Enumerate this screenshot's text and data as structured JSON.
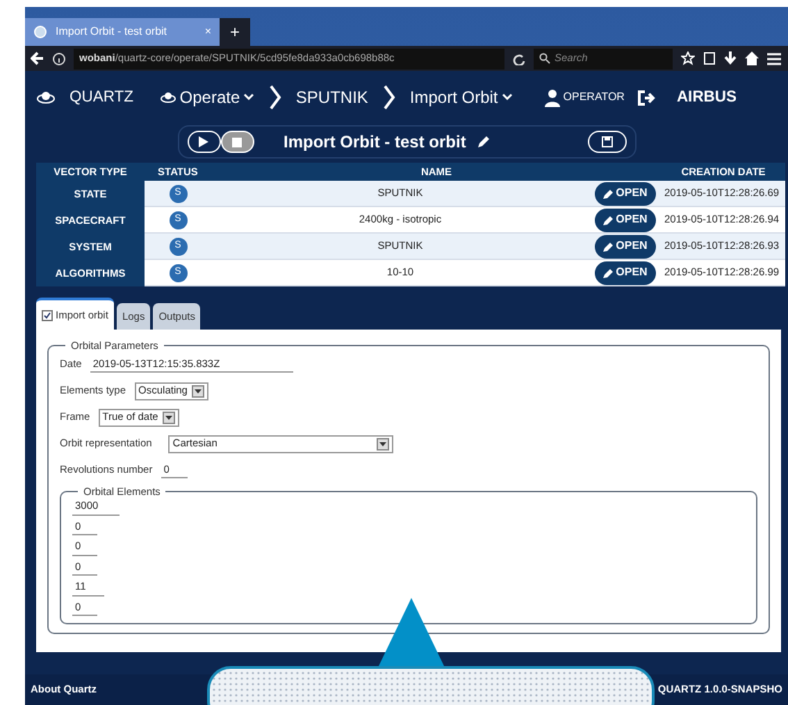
{
  "browser": {
    "tab_title": "Import Orbit - test orbit",
    "tab_close": "×",
    "new_tab": "+",
    "url_host": "wobani",
    "url_path": "/quartz-core/operate/SPUTNIK/5cd95fe8da933a0cb698b88c",
    "search_placeholder": "Search"
  },
  "nav": {
    "brand": "QUARTZ",
    "crumbs": [
      {
        "label": "Operate",
        "dropdown": true,
        "icon": true
      },
      {
        "label": "SPUTNIK",
        "dropdown": false,
        "icon": false
      },
      {
        "label": "Import Orbit",
        "dropdown": true,
        "icon": false
      }
    ],
    "user": "OPERATOR",
    "logo": "AIRBUS"
  },
  "toolbar": {
    "title": "Import Orbit -  test orbit"
  },
  "table": {
    "columns": [
      "VECTOR TYPE",
      "STATUS",
      "NAME",
      "CREATION DATE"
    ],
    "rows": [
      {
        "vector_type": "STATE",
        "status": "S",
        "name": "SPUTNIK",
        "action": "OPEN",
        "creation_date": "2019-05-10T12:28:26.69"
      },
      {
        "vector_type": "SPACECRAFT",
        "status": "S",
        "name": "2400kg - isotropic",
        "action": "OPEN",
        "creation_date": "2019-05-10T12:28:26.94"
      },
      {
        "vector_type": "SYSTEM",
        "status": "S",
        "name": "SPUTNIK",
        "action": "OPEN",
        "creation_date": "2019-05-10T12:28:26.93"
      },
      {
        "vector_type": "ALGORITHMS",
        "status": "S",
        "name": "10-10",
        "action": "OPEN",
        "creation_date": "2019-05-10T12:28:26.99"
      }
    ]
  },
  "tabs": [
    {
      "label": "Import orbit",
      "selected": true,
      "checked": true
    },
    {
      "label": "Logs",
      "selected": false
    },
    {
      "label": "Outputs",
      "selected": false
    }
  ],
  "orbital_parameters": {
    "legend": "Orbital Parameters",
    "fields": [
      {
        "kind": "text",
        "label": "Date",
        "value": "2019-05-13T12:15:35.833Z"
      },
      {
        "kind": "select",
        "label": "Elements type",
        "value": "Osculating"
      },
      {
        "kind": "select",
        "label": "Frame",
        "value": "True of date"
      },
      {
        "kind": "wideselect",
        "label": "Orbit representation",
        "value": "Cartesian"
      },
      {
        "kind": "text",
        "label": "Revolutions number",
        "value": "0"
      }
    ]
  },
  "orbital_elements": {
    "legend": "Orbital Elements",
    "values": [
      "3000",
      "0",
      "0",
      "0",
      "11",
      "0"
    ]
  },
  "footer": {
    "left": "About Quartz",
    "right": "QUARTZ 1.0.0-SNAPSHO"
  }
}
